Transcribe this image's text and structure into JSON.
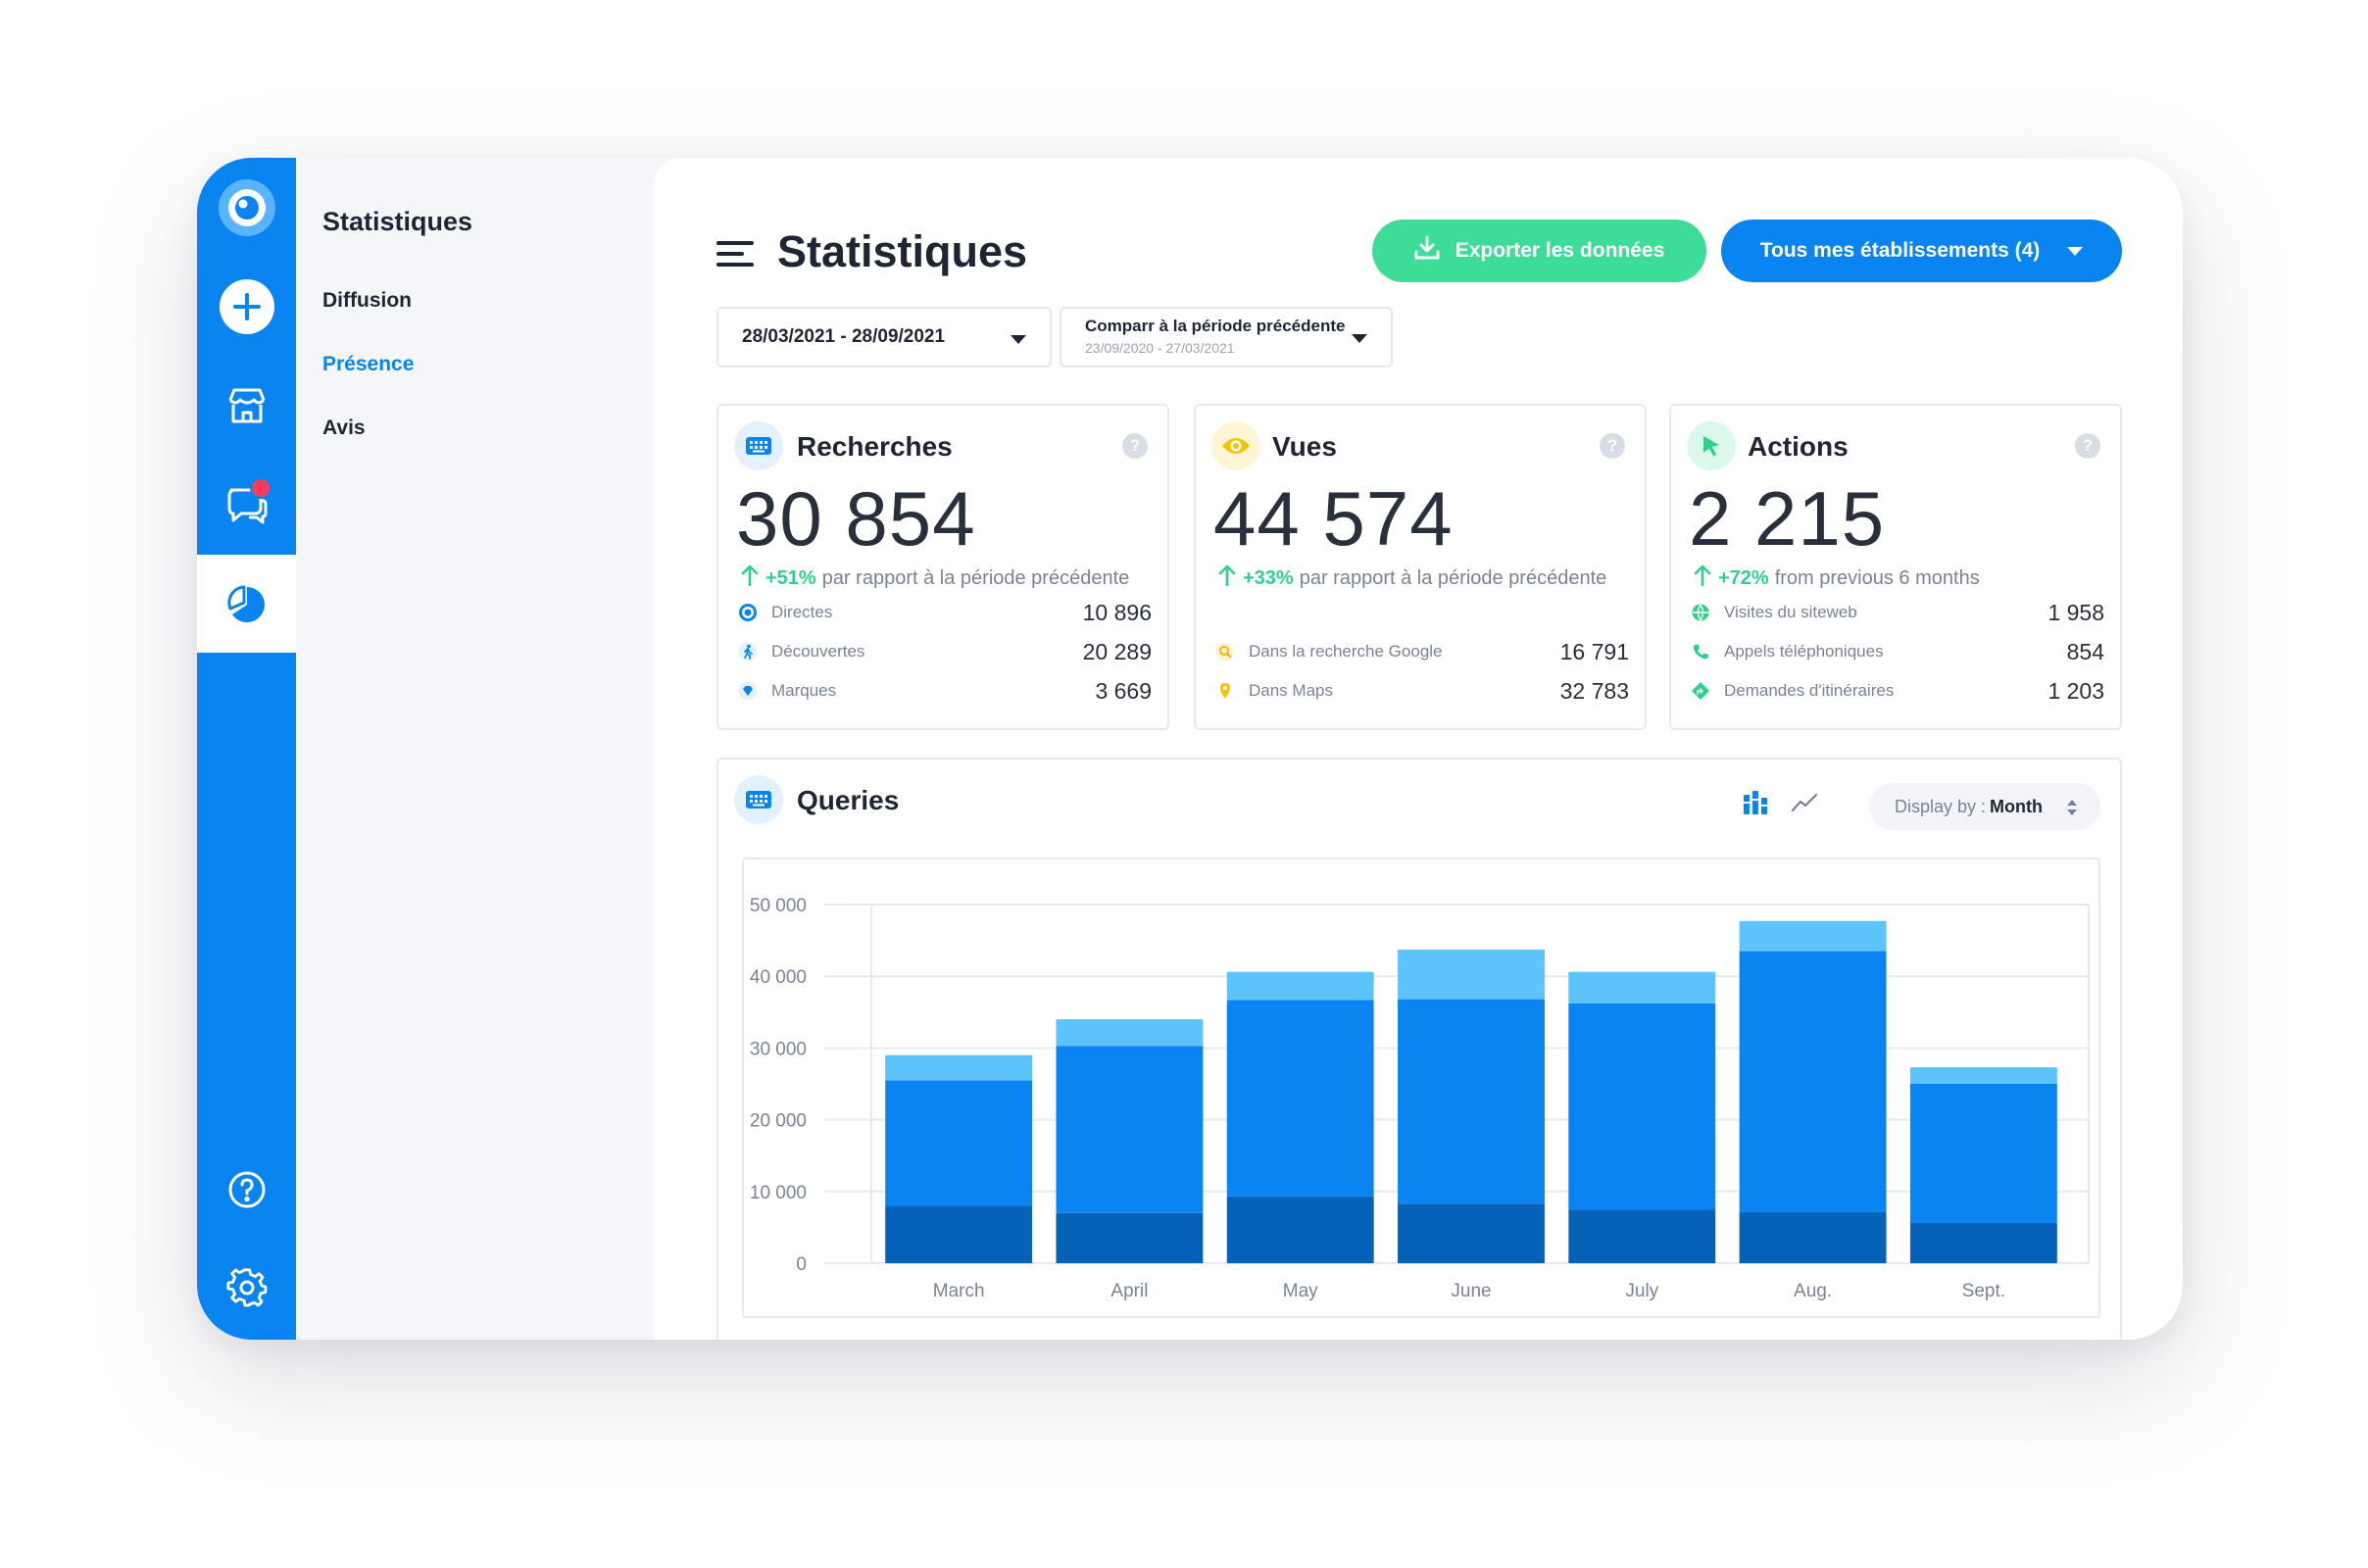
{
  "sidebar": {
    "items": [
      {
        "name": "logo",
        "icon": "eye-logo-icon"
      },
      {
        "name": "add",
        "icon": "plus-icon"
      },
      {
        "name": "store",
        "icon": "store-icon"
      },
      {
        "name": "messages",
        "icon": "chat-icon",
        "notification": true
      },
      {
        "name": "statistics",
        "icon": "pie-chart-icon",
        "active": true
      },
      {
        "name": "help",
        "icon": "help-icon"
      },
      {
        "name": "settings",
        "icon": "gear-icon"
      }
    ]
  },
  "subnav": {
    "title": "Statistiques",
    "items": [
      {
        "label": "Diffusion",
        "active": false
      },
      {
        "label": "Présence",
        "active": true
      },
      {
        "label": "Avis",
        "active": false
      }
    ]
  },
  "header": {
    "title": "Statistiques",
    "export_label": "Exporter les données",
    "stores_label": "Tous mes établissements (4)"
  },
  "filters": {
    "date_range": "28/03/2021 - 28/09/2021",
    "compare_label": "Comparr à la période précédente",
    "compare_range": "23/09/2020 - 27/03/2021"
  },
  "cards": [
    {
      "title": "Recherches",
      "value": "30 854",
      "delta": "+51%",
      "delta_text": "par rapport à la période précédente",
      "rows": [
        {
          "label": "Directes",
          "value": "10 896",
          "icon": "target-icon"
        },
        {
          "label": "Découvertes",
          "value": "20 289",
          "icon": "walker-icon"
        },
        {
          "label": "Marques",
          "value": "3 669",
          "icon": "diamond-icon"
        }
      ]
    },
    {
      "title": "Vues",
      "value": "44 574",
      "delta": "+33%",
      "delta_text": "par rapport à la période précédente",
      "rows": [
        {
          "label": "Dans la recherche Google",
          "value": "16 791",
          "icon": "search-icon"
        },
        {
          "label": "Dans Maps",
          "value": "32 783",
          "icon": "map-pin-icon"
        }
      ]
    },
    {
      "title": "Actions",
      "value": "2 215",
      "delta": "+72%",
      "delta_text": "from previous 6 months",
      "rows": [
        {
          "label": "Visites du siteweb",
          "value": "1 958",
          "icon": "globe-icon"
        },
        {
          "label": "Appels téléphoniques",
          "value": "854",
          "icon": "phone-icon"
        },
        {
          "label": "Demandes d'itinéraires",
          "value": "1 203",
          "icon": "directions-icon"
        }
      ]
    }
  ],
  "queries": {
    "title": "Queries",
    "display_prefix": "Display by :",
    "display_value": "Month"
  },
  "colors": {
    "primary": "#0a84f0",
    "green": "#3ddc98",
    "bar_dark": "#0562b8",
    "bar_mid": "#0a84f0",
    "bar_light": "#5cc3fb"
  },
  "chart_data": {
    "type": "bar",
    "stacked": true,
    "categories": [
      "March",
      "April",
      "May",
      "June",
      "July",
      "Aug.",
      "Sept."
    ],
    "series": [
      {
        "values": [
          8000,
          7000,
          9300,
          8300,
          7500,
          7100,
          5600
        ]
      },
      {
        "values": [
          17500,
          23300,
          27400,
          28500,
          28700,
          36400,
          19400
        ]
      },
      {
        "values": [
          3500,
          3700,
          3900,
          6900,
          4400,
          4200,
          2300
        ]
      }
    ],
    "y_ticks": [
      "50 000",
      "40 000",
      "30 000",
      "20 000",
      "10 000",
      "0"
    ],
    "ylim": [
      0,
      50000
    ],
    "grid": true
  }
}
